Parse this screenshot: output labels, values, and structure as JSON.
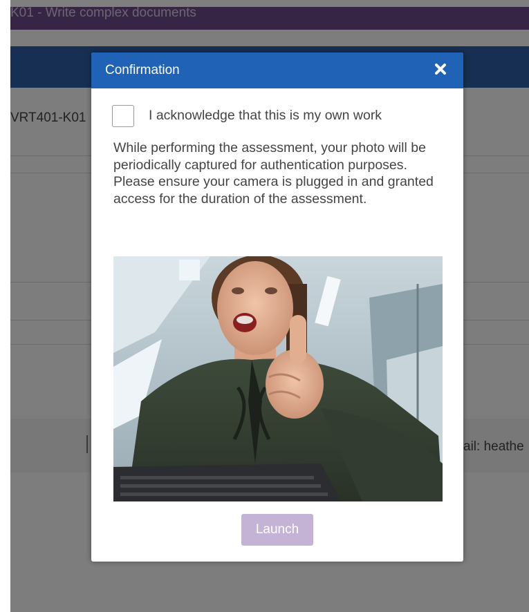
{
  "background": {
    "topbar_title": "K01 - Write complex documents",
    "course_code": "VRT401-K01",
    "email_partial": "ail: heathe"
  },
  "modal": {
    "title": "Confirmation",
    "close_icon": "close-icon",
    "acknowledge": {
      "checked": false,
      "label": "I acknowledge that this is my own work"
    },
    "info_line1": "While performing the assessment, your photo will be periodically captured for authentication purposes.",
    "info_line2": "Please ensure your camera is plugged in and granted access for the duration of the assessment.",
    "launch_label": "Launch"
  },
  "colors": {
    "header_blue": "#2062b5",
    "launch_disabled": "#c5b3d6",
    "topbar_purple": "#6c4b8a"
  }
}
